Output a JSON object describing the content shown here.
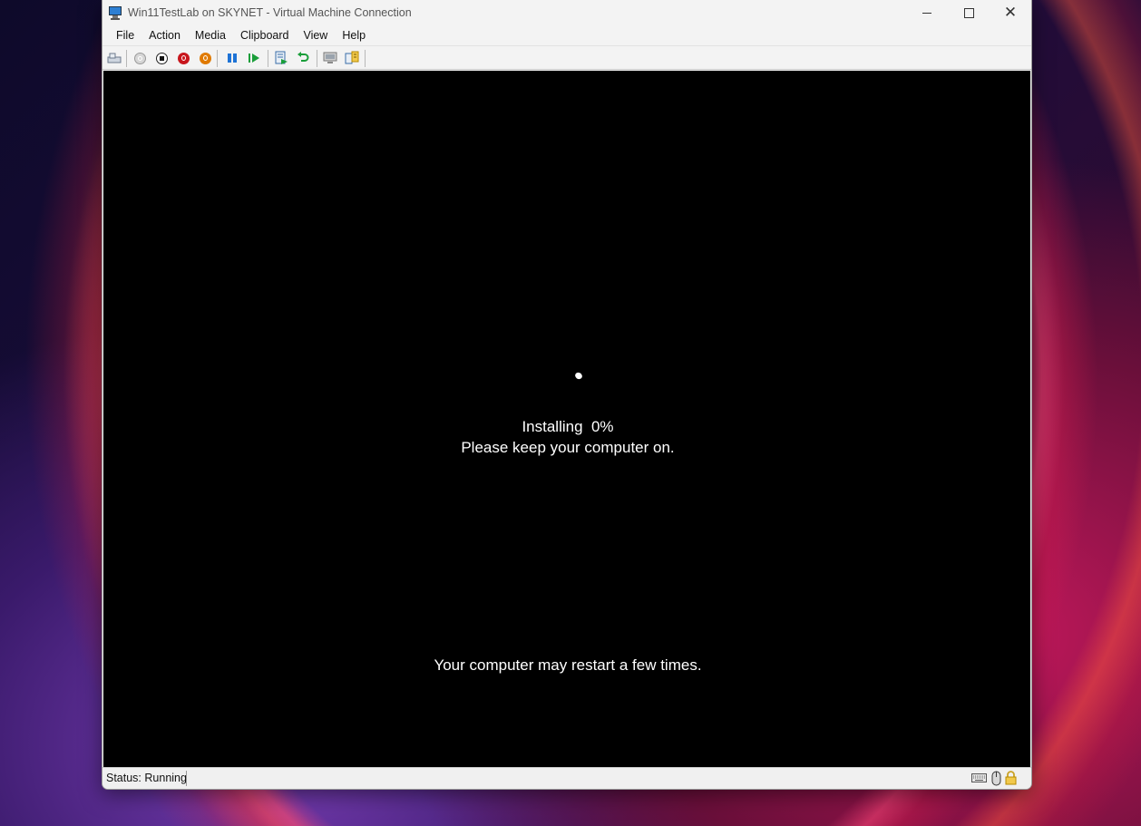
{
  "window": {
    "title": "Win11TestLab on SKYNET - Virtual Machine Connection",
    "caption_buttons": {
      "minimize": "minimize",
      "maximize": "maximize",
      "close": "✕"
    }
  },
  "menu": {
    "items": [
      {
        "label": "File"
      },
      {
        "label": "Action"
      },
      {
        "label": "Media"
      },
      {
        "label": "Clipboard"
      },
      {
        "label": "View"
      },
      {
        "label": "Help"
      }
    ]
  },
  "toolbar": {
    "buttons": [
      {
        "name": "ctrl-alt-del",
        "icon": "ctrl-alt-del-icon"
      },
      {
        "name": "start",
        "icon": "power-gray-icon"
      },
      {
        "name": "turn-off",
        "icon": "stop-icon"
      },
      {
        "name": "shut-down",
        "icon": "power-red-icon"
      },
      {
        "name": "save",
        "icon": "power-orange-icon"
      },
      {
        "name": "pause",
        "icon": "pause-icon"
      },
      {
        "name": "resume",
        "icon": "resume-icon"
      },
      {
        "name": "checkpoint",
        "icon": "checkpoint-icon"
      },
      {
        "name": "revert",
        "icon": "revert-icon"
      },
      {
        "name": "enhanced-session",
        "icon": "enhanced-session-icon"
      },
      {
        "name": "share",
        "icon": "share-icon"
      }
    ],
    "colors": {
      "power_red": "#c8161d",
      "power_orange": "#e07a00",
      "action_blue": "#1e73d6",
      "action_green": "#1a9e3a"
    }
  },
  "vm_screen": {
    "installing": "Installing  0%",
    "keep_on": "Please keep your computer on.",
    "restart_notice": "Your computer may restart a few times.",
    "progress_percent": 0
  },
  "status_bar": {
    "status": "Status: Running",
    "icons": [
      "keyboard-icon",
      "mouse-icon",
      "lock-icon"
    ]
  }
}
